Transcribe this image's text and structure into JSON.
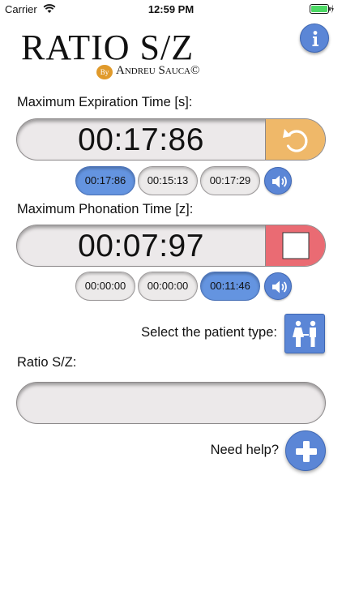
{
  "status_bar": {
    "carrier": "Carrier",
    "time": "12:59 PM",
    "wifi_icon": "wifi-icon",
    "battery_icon": "battery-charging-icon"
  },
  "logo": {
    "title": "RATIO S/Z",
    "by": "By",
    "author": "Andreu Sauca©"
  },
  "info_button": {
    "icon": "info-icon"
  },
  "expiration": {
    "label": "Maximum Expiration Time [s]:",
    "time": "00:17:86",
    "action_icon": "reset-icon",
    "action_color": "#efb869",
    "laps": [
      "00:17:86",
      "00:15:13",
      "00:17:29"
    ],
    "selected_lap": 0
  },
  "phonation": {
    "label": "Maximum Phonation Time [z]:",
    "time": "00:07:97",
    "action_icon": "stop-icon",
    "action_color": "#ea6b73",
    "laps": [
      "00:00:00",
      "00:00:00",
      "00:11:46"
    ],
    "selected_lap": 2
  },
  "patient": {
    "label": "Select the patient type:",
    "icon": "adult-couple-icon"
  },
  "ratio": {
    "label": "Ratio S/Z:",
    "value": ""
  },
  "help": {
    "label": "Need help?",
    "icon": "plus-icon"
  },
  "colors": {
    "accent_blue": "#5b86d6",
    "selected_chip": "#6494e0",
    "field_gray": "#ece9ea"
  }
}
